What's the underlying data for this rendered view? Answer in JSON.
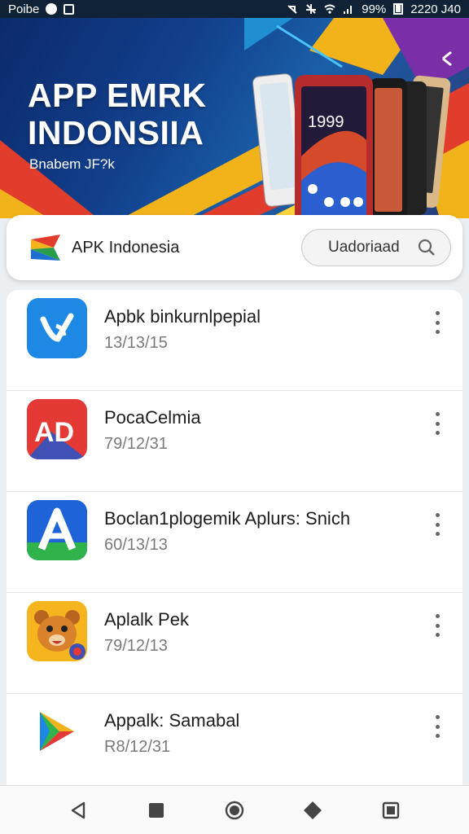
{
  "status_bar": {
    "left_text": "Poibe",
    "left_icons": [
      "sync-icon",
      "image-icon"
    ],
    "right_icons": [
      "mute-icon",
      "airplane-off-icon",
      "wifi-icon",
      "signal-icon"
    ],
    "battery": "99%",
    "time": "2220 J40"
  },
  "banner": {
    "title_line1": "APP EMRK",
    "title_line2": "INDONSIIA",
    "subtitle": "Bnabem JF?k",
    "colors": [
      "#0b2a6b",
      "#f2b21a",
      "#e23c2c",
      "#7a2fa8"
    ]
  },
  "header": {
    "title": "APK Indonesia",
    "download_label": "Uadoriaad",
    "logo_icon": "apk-indonesia-logo-icon",
    "search_icon": "search-icon"
  },
  "apps": [
    {
      "name": "Apbk binkurnlpepial",
      "date": "13/13/15",
      "icon": "blue-y-icon"
    },
    {
      "name": "PocaCelmia",
      "date": "79/12/31",
      "icon": "red-ad-icon"
    },
    {
      "name": "Boclan1plogemik Aplurs: Snich",
      "date": "60/13/13",
      "icon": "green-a-icon"
    },
    {
      "name": "Aplalk Pek",
      "date": "79/12/13",
      "icon": "bear-icon"
    },
    {
      "name": "Appalk: Samabal",
      "date": "R8/12/31",
      "icon": "play-icon"
    }
  ],
  "nav": [
    "back-icon",
    "square-icon",
    "home-icon",
    "diamond-icon",
    "recents-icon"
  ]
}
